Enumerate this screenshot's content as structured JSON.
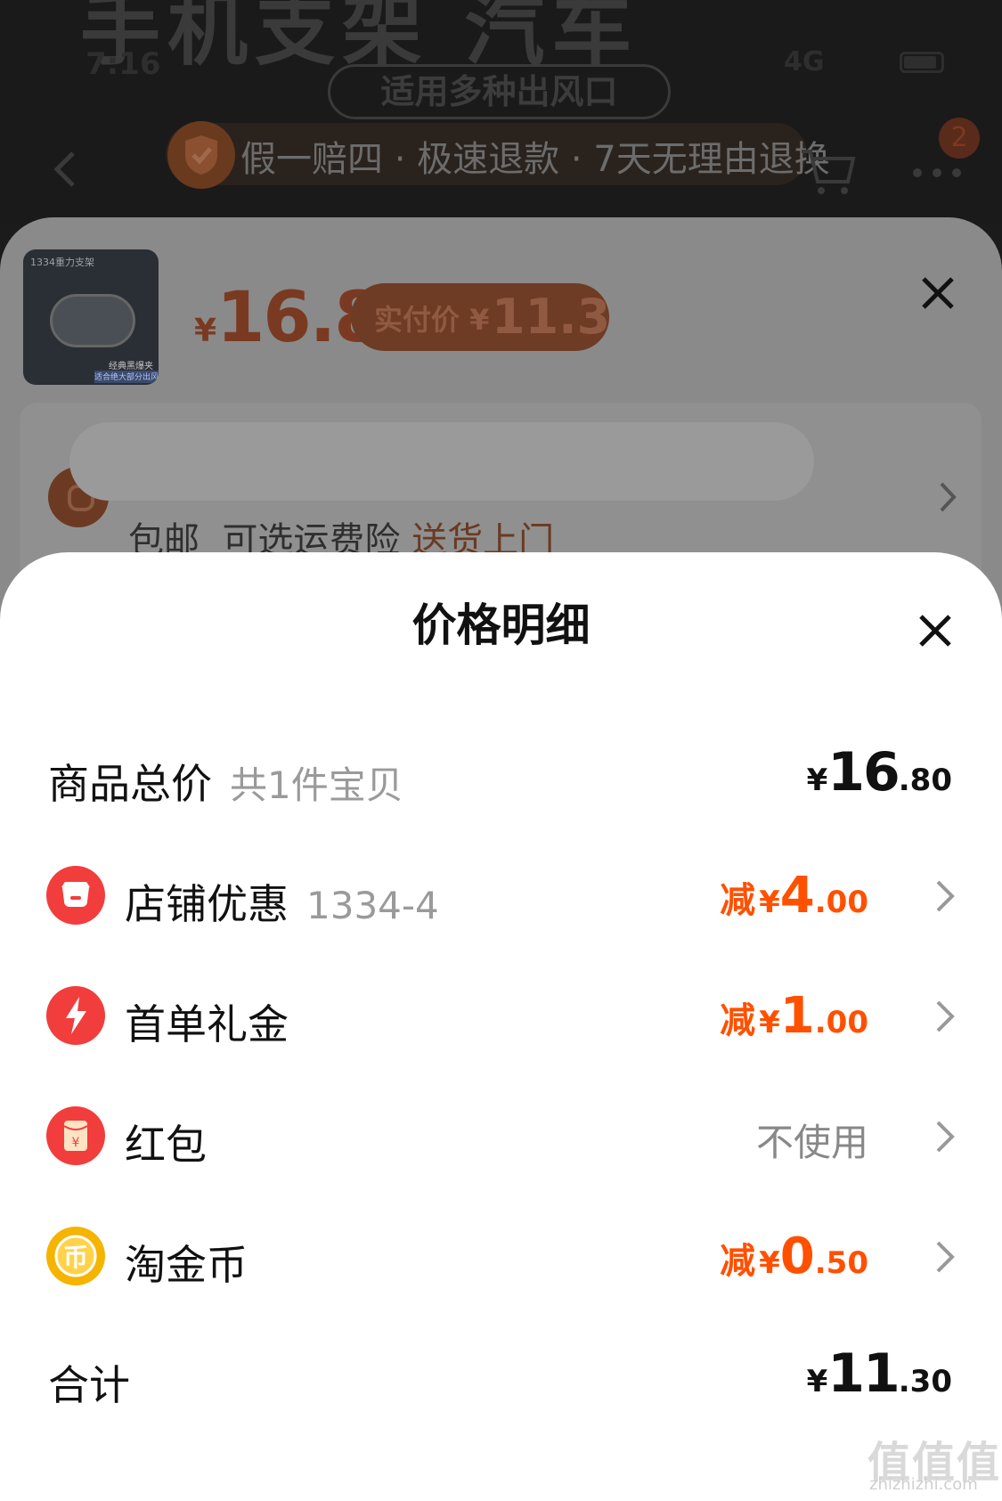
{
  "status_bar": {
    "time": "7:16",
    "network": "4G"
  },
  "product_banner": {
    "headline": "手机支架 汽车",
    "tag": "适用多种出风口",
    "guarantee": "假一赔四 · 极速退款 · 7天无理由退换",
    "cart_count": "2"
  },
  "product": {
    "thumb_caption": "1334重力支架",
    "thumb_tag": "经典黑爆夹",
    "thumb_tag2": "适合绝大部分出风口",
    "price_symbol": "¥",
    "price": "16.8",
    "paid_label": "实付价",
    "paid_symbol": "¥",
    "paid_price": "11.3"
  },
  "address": {
    "shipping": "包邮",
    "insurance": "可选运费险",
    "delivery": "送货上门"
  },
  "sheet": {
    "title": "价格明细",
    "rows": [
      {
        "label": "商品总价",
        "sub": "共1件宝贝",
        "symbol": "¥",
        "int": "16",
        "dec": ".80"
      },
      {
        "label": "店铺优惠",
        "sub": "1334-4",
        "prefix": "减",
        "symbol": "¥",
        "int": "4",
        "dec": ".00",
        "icon": "store-icon",
        "icon_color": "#f23d3d"
      },
      {
        "label": "首单礼金",
        "prefix": "减",
        "symbol": "¥",
        "int": "1",
        "dec": ".00",
        "icon": "lightning-icon",
        "icon_color": "#f23d3d"
      },
      {
        "label": "红包",
        "value": "不使用",
        "icon": "red-packet-icon",
        "icon_color": "#f23d3d"
      },
      {
        "label": "淘金币",
        "prefix": "减",
        "symbol": "¥",
        "int": "0",
        "dec": ".50",
        "icon": "coin-icon",
        "icon_color": "#f5b400"
      }
    ],
    "total": {
      "label": "合计",
      "symbol": "¥",
      "int": "11",
      "dec": ".30"
    }
  },
  "watermark": {
    "text": "值值值",
    "sub": "zhizhizhi.com"
  },
  "colors": {
    "accent": "#ff5000",
    "sheet_bg": "#ffffff",
    "dim_bg": "#8a8a8a"
  }
}
